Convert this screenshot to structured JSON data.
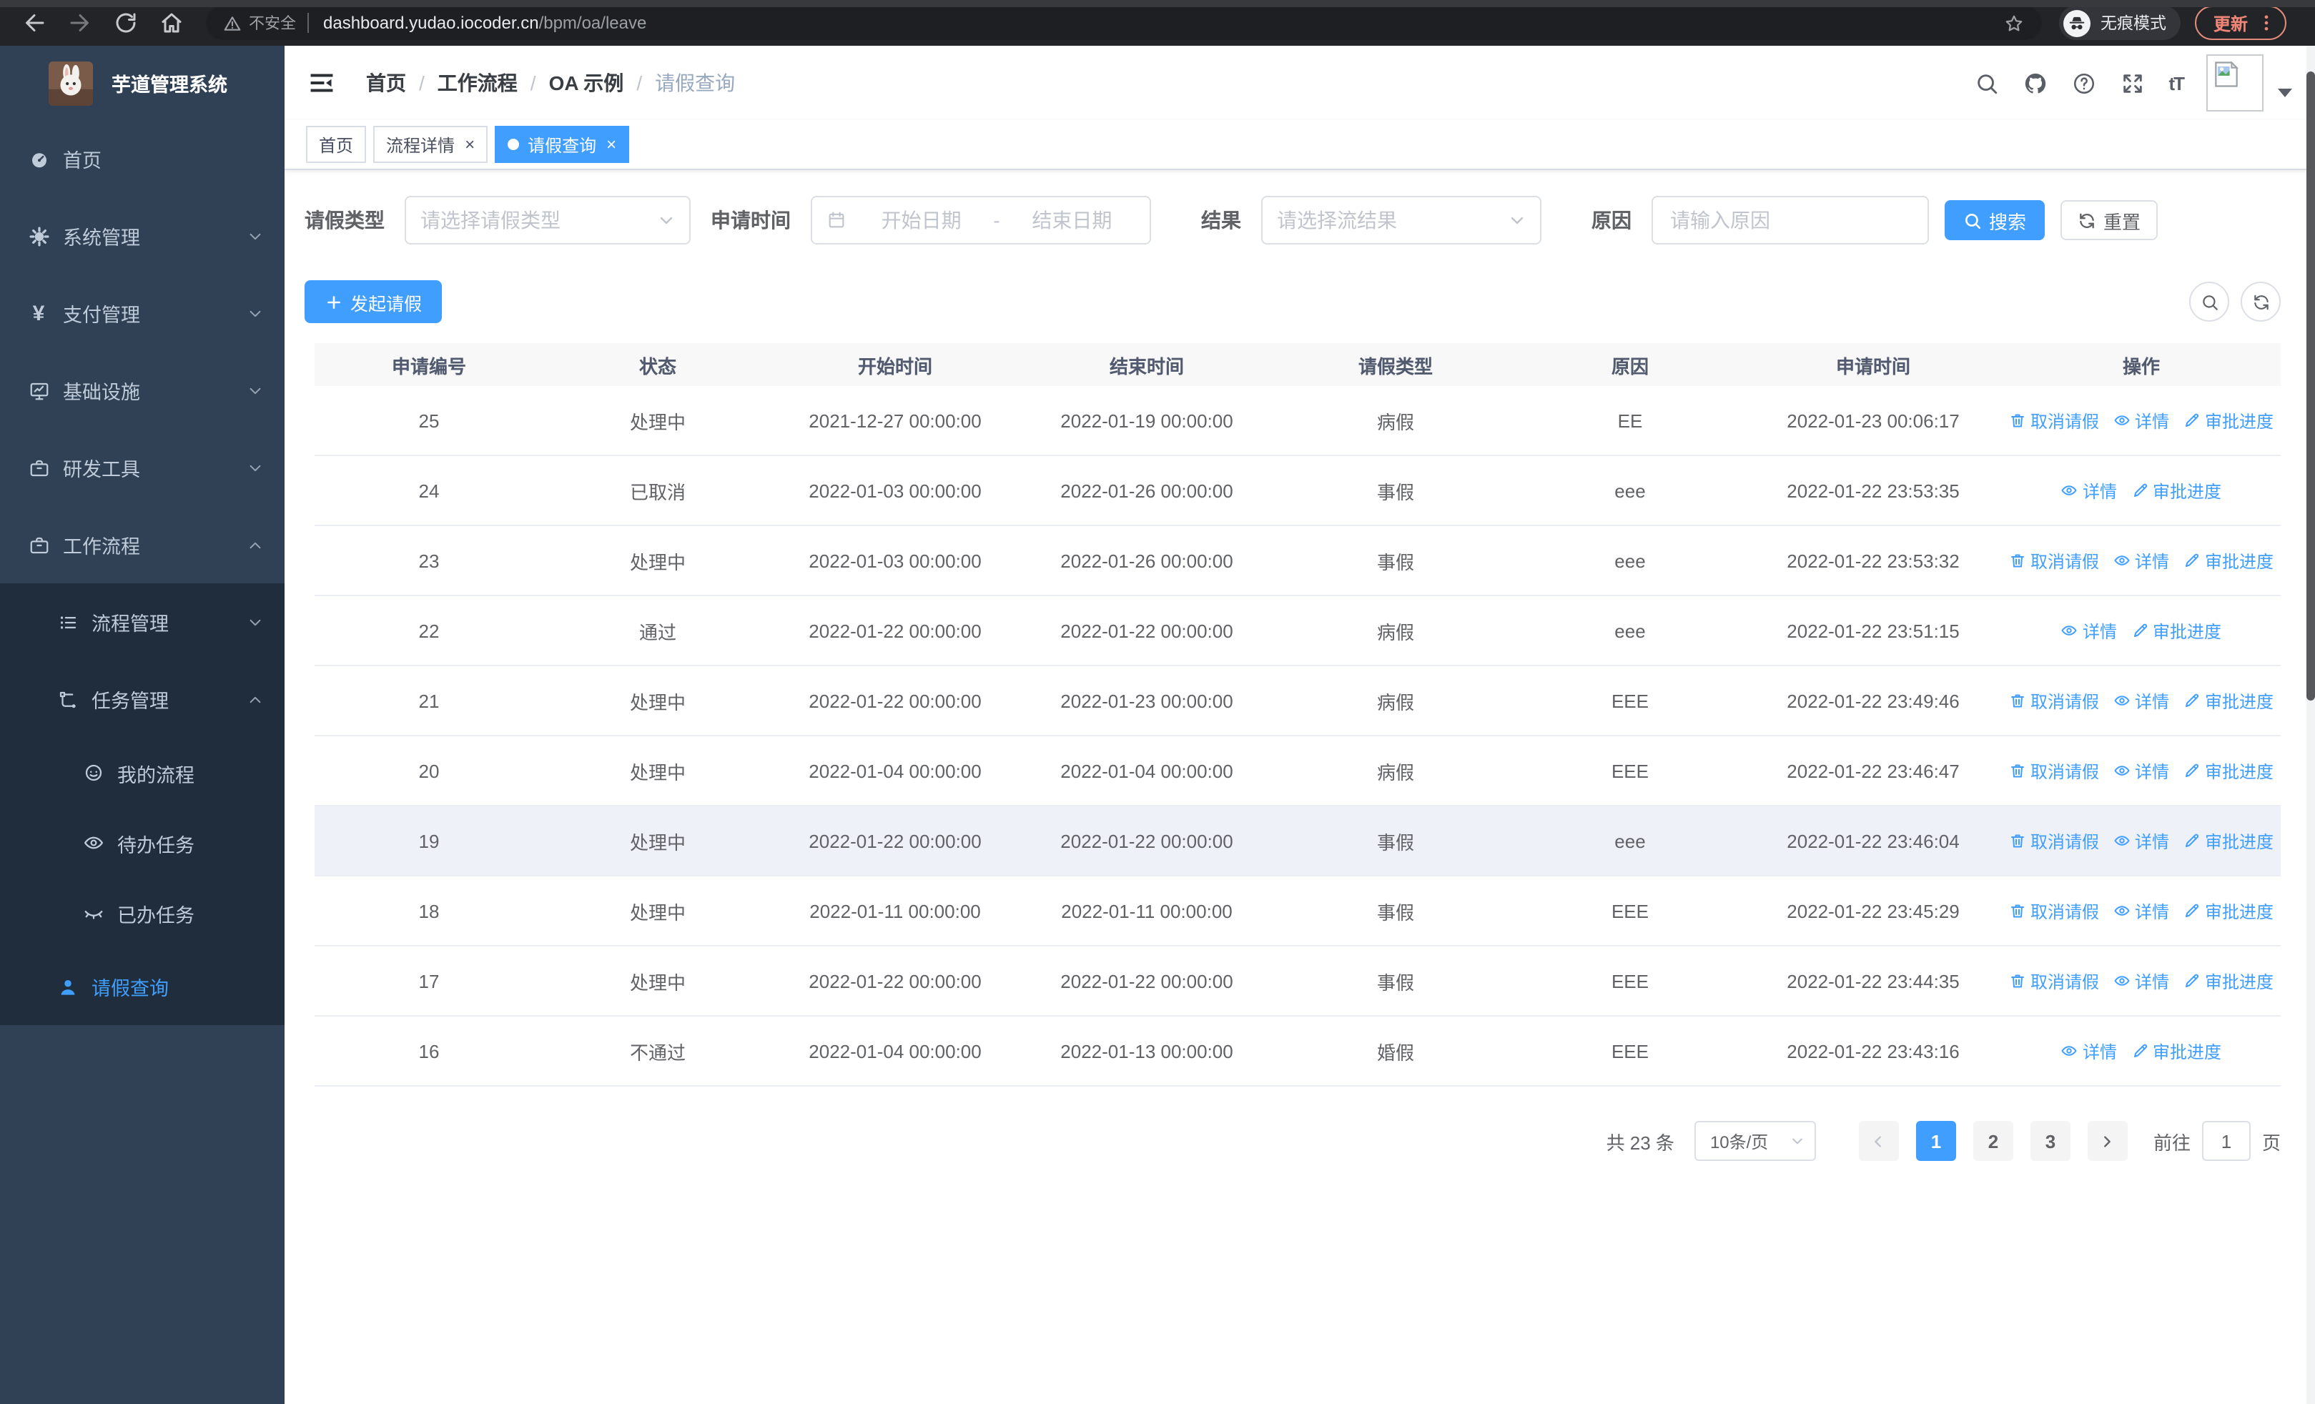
{
  "colors": {
    "primary": "#409eff",
    "sidebar_bg": "#304156",
    "submenu_bg": "#1f2d3d"
  },
  "browser": {
    "security_label": "不安全",
    "url_host": "dashboard.yudao.iocoder.cn",
    "url_path": "/bpm/oa/leave",
    "incognito_label": "无痕模式",
    "update_label": "更新"
  },
  "sidebar": {
    "title": "芋道管理系统",
    "items": [
      {
        "id": "home",
        "icon": "dashboard-icon",
        "label": "首页",
        "level": 1,
        "in_submenu": false,
        "active": false,
        "chevron": ""
      },
      {
        "id": "system",
        "icon": "gear-icon",
        "label": "系统管理",
        "level": 1,
        "in_submenu": false,
        "active": false,
        "chevron": "down"
      },
      {
        "id": "payment",
        "icon": "yen-icon",
        "label": "支付管理",
        "level": 1,
        "in_submenu": false,
        "active": false,
        "chevron": "down"
      },
      {
        "id": "infrastructure",
        "icon": "monitor-icon",
        "label": "基础设施",
        "level": 1,
        "in_submenu": false,
        "active": false,
        "chevron": "down"
      },
      {
        "id": "dev-tools",
        "icon": "toolbox-icon",
        "label": "研发工具",
        "level": 1,
        "in_submenu": false,
        "active": false,
        "chevron": "down"
      },
      {
        "id": "workflow",
        "icon": "briefcase-icon",
        "label": "工作流程",
        "level": 1,
        "in_submenu": false,
        "active": false,
        "chevron": "up"
      },
      {
        "id": "process-mgmt",
        "icon": "list-icon",
        "label": "流程管理",
        "level": 2,
        "in_submenu": true,
        "active": false,
        "chevron": "down"
      },
      {
        "id": "task-mgmt",
        "icon": "flow-icon",
        "label": "任务管理",
        "level": 2,
        "in_submenu": true,
        "active": false,
        "chevron": "up"
      },
      {
        "id": "my-process",
        "icon": "face-icon",
        "label": "我的流程",
        "level": 3,
        "in_submenu": true,
        "active": false,
        "chevron": ""
      },
      {
        "id": "todo-task",
        "icon": "eye-open-icon",
        "label": "待办任务",
        "level": 3,
        "in_submenu": true,
        "active": false,
        "chevron": ""
      },
      {
        "id": "done-task",
        "icon": "eye-closed-icon",
        "label": "已办任务",
        "level": 3,
        "in_submenu": true,
        "active": false,
        "chevron": ""
      },
      {
        "id": "leave-query",
        "icon": "user-icon",
        "label": "请假查询",
        "level": 2,
        "in_submenu": true,
        "active": true,
        "chevron": ""
      }
    ]
  },
  "header": {
    "breadcrumb": [
      "首页",
      "工作流程",
      "OA 示例",
      "请假查询"
    ]
  },
  "tabs": [
    {
      "label": "首页",
      "closable": false,
      "active": false
    },
    {
      "label": "流程详情",
      "closable": true,
      "active": false
    },
    {
      "label": "请假查询",
      "closable": true,
      "active": true
    }
  ],
  "filters": {
    "leave_type_label": "请假类型",
    "leave_type_placeholder": "请选择请假类型",
    "apply_time_label": "申请时间",
    "start_date_placeholder": "开始日期",
    "range_separator": "-",
    "end_date_placeholder": "结束日期",
    "result_label": "结果",
    "result_placeholder": "请选择流结果",
    "reason_label": "原因",
    "reason_placeholder": "请输入原因",
    "search_label": "搜索",
    "reset_label": "重置"
  },
  "toolbar": {
    "create_label": "发起请假"
  },
  "table": {
    "columns": [
      "申请编号",
      "状态",
      "开始时间",
      "结束时间",
      "请假类型",
      "原因",
      "申请时间",
      "操作"
    ],
    "action_labels": {
      "cancel": "取消请假",
      "detail": "详情",
      "progress": "审批进度"
    },
    "rows": [
      {
        "id": "25",
        "status": "处理中",
        "start": "2021-12-27 00:00:00",
        "end": "2022-01-19 00:00:00",
        "type": "病假",
        "reason": "EE",
        "apply_time": "2022-01-23 00:06:17",
        "actions": [
          "cancel",
          "detail",
          "progress"
        ],
        "highlight": false
      },
      {
        "id": "24",
        "status": "已取消",
        "start": "2022-01-03 00:00:00",
        "end": "2022-01-26 00:00:00",
        "type": "事假",
        "reason": "eee",
        "apply_time": "2022-01-22 23:53:35",
        "actions": [
          "detail",
          "progress"
        ],
        "highlight": false
      },
      {
        "id": "23",
        "status": "处理中",
        "start": "2022-01-03 00:00:00",
        "end": "2022-01-26 00:00:00",
        "type": "事假",
        "reason": "eee",
        "apply_time": "2022-01-22 23:53:32",
        "actions": [
          "cancel",
          "detail",
          "progress"
        ],
        "highlight": false
      },
      {
        "id": "22",
        "status": "通过",
        "start": "2022-01-22 00:00:00",
        "end": "2022-01-22 00:00:00",
        "type": "病假",
        "reason": "eee",
        "apply_time": "2022-01-22 23:51:15",
        "actions": [
          "detail",
          "progress"
        ],
        "highlight": false
      },
      {
        "id": "21",
        "status": "处理中",
        "start": "2022-01-22 00:00:00",
        "end": "2022-01-23 00:00:00",
        "type": "病假",
        "reason": "EEE",
        "apply_time": "2022-01-22 23:49:46",
        "actions": [
          "cancel",
          "detail",
          "progress"
        ],
        "highlight": false
      },
      {
        "id": "20",
        "status": "处理中",
        "start": "2022-01-04 00:00:00",
        "end": "2022-01-04 00:00:00",
        "type": "病假",
        "reason": "EEE",
        "apply_time": "2022-01-22 23:46:47",
        "actions": [
          "cancel",
          "detail",
          "progress"
        ],
        "highlight": false
      },
      {
        "id": "19",
        "status": "处理中",
        "start": "2022-01-22 00:00:00",
        "end": "2022-01-22 00:00:00",
        "type": "事假",
        "reason": "eee",
        "apply_time": "2022-01-22 23:46:04",
        "actions": [
          "cancel",
          "detail",
          "progress"
        ],
        "highlight": true
      },
      {
        "id": "18",
        "status": "处理中",
        "start": "2022-01-11 00:00:00",
        "end": "2022-01-11 00:00:00",
        "type": "事假",
        "reason": "EEE",
        "apply_time": "2022-01-22 23:45:29",
        "actions": [
          "cancel",
          "detail",
          "progress"
        ],
        "highlight": false
      },
      {
        "id": "17",
        "status": "处理中",
        "start": "2022-01-22 00:00:00",
        "end": "2022-01-22 00:00:00",
        "type": "事假",
        "reason": "EEE",
        "apply_time": "2022-01-22 23:44:35",
        "actions": [
          "cancel",
          "detail",
          "progress"
        ],
        "highlight": false
      },
      {
        "id": "16",
        "status": "不通过",
        "start": "2022-01-04 00:00:00",
        "end": "2022-01-13 00:00:00",
        "type": "婚假",
        "reason": "EEE",
        "apply_time": "2022-01-22 23:43:16",
        "actions": [
          "detail",
          "progress"
        ],
        "highlight": false
      }
    ]
  },
  "pagination": {
    "total_label": "共 23 条",
    "page_size": "10条/页",
    "pages": [
      "1",
      "2",
      "3"
    ],
    "active_page": "1",
    "goto_label": "前往",
    "goto_value": "1",
    "page_suffix": "页"
  }
}
